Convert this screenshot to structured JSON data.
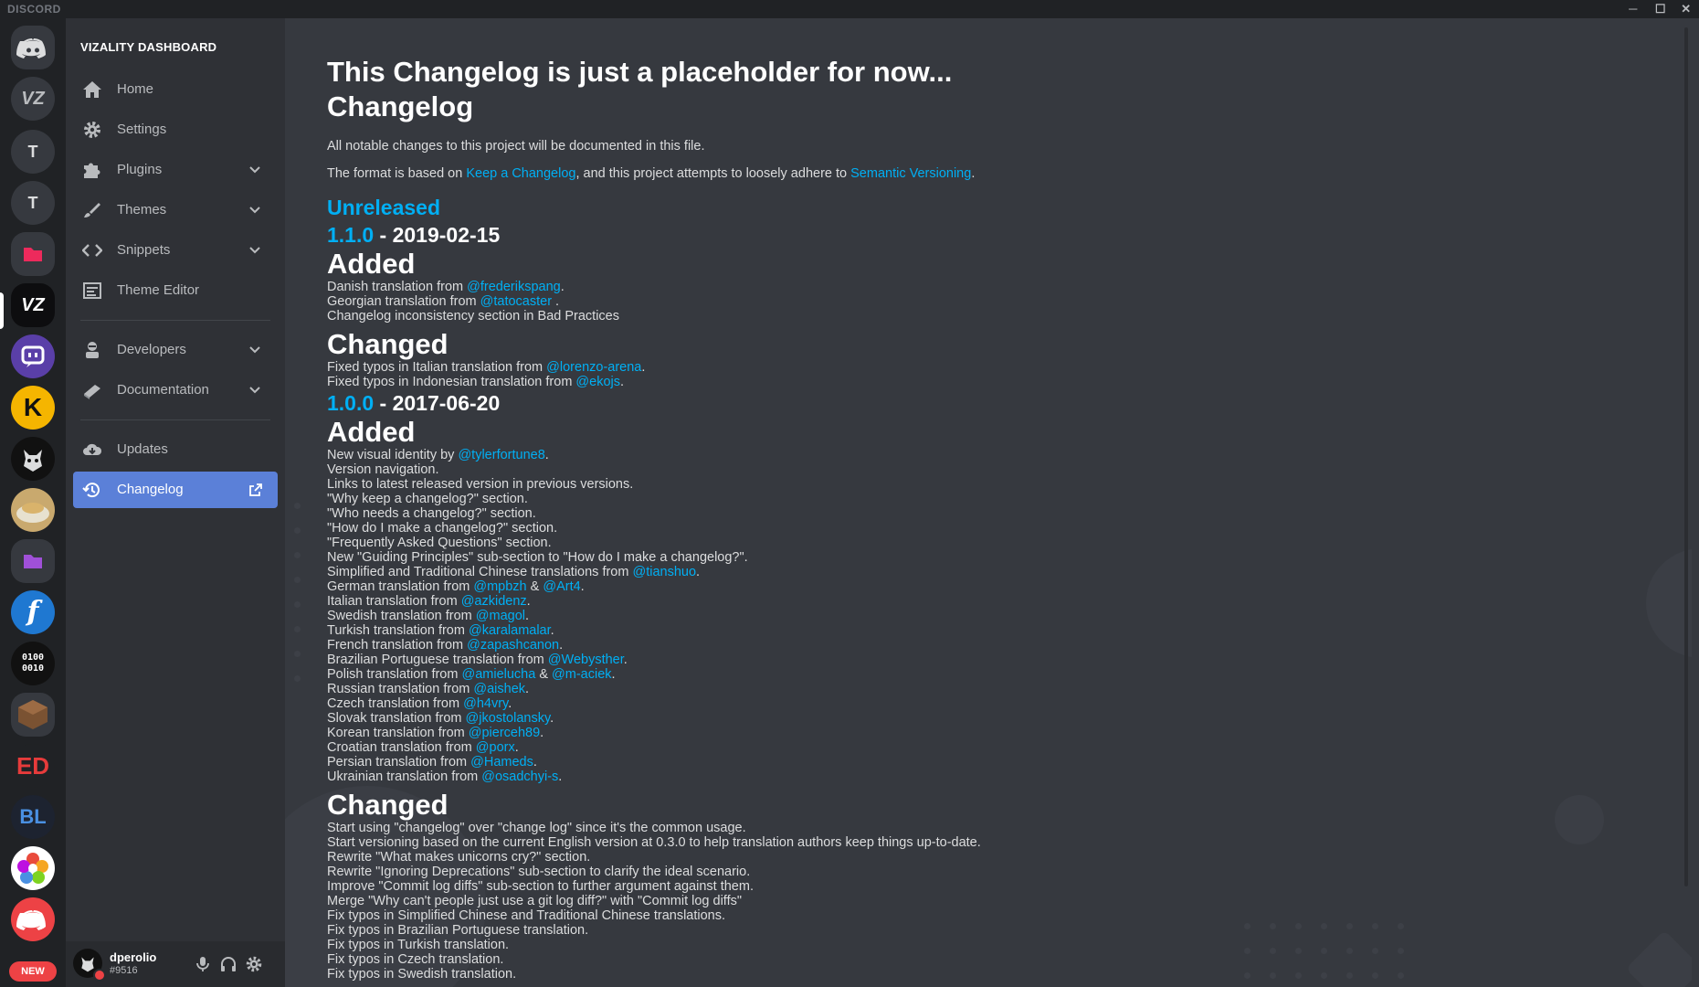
{
  "window": {
    "brand": "DISCORD",
    "minimize": "─",
    "maximize": "☐",
    "close": "✕"
  },
  "rail": {
    "servers": [
      {
        "name": "discord-home",
        "label": ""
      },
      {
        "name": "vizality",
        "label": "VZ"
      },
      {
        "name": "t1",
        "label": "T"
      },
      {
        "name": "t2",
        "label": "T"
      },
      {
        "name": "folder-red",
        "label": ""
      },
      {
        "name": "vizality-active",
        "label": "VZ"
      },
      {
        "name": "twitch-like",
        "label": ""
      },
      {
        "name": "k-server",
        "label": "K"
      },
      {
        "name": "demon-server",
        "label": ""
      },
      {
        "name": "food-server",
        "label": ""
      },
      {
        "name": "folder-purple",
        "label": ""
      },
      {
        "name": "f-server",
        "label": "f"
      },
      {
        "name": "binary-server",
        "label": "0100 0010"
      },
      {
        "name": "minecraft-server",
        "label": ""
      },
      {
        "name": "ed-server",
        "label": "ED"
      },
      {
        "name": "bl-server",
        "label": "BL"
      },
      {
        "name": "flower-server",
        "label": ""
      },
      {
        "name": "discord-red",
        "label": ""
      }
    ],
    "new_badge": "NEW"
  },
  "sidebar": {
    "title": "VIZALITY DASHBOARD",
    "items": [
      {
        "label": "Home"
      },
      {
        "label": "Settings"
      },
      {
        "label": "Plugins"
      },
      {
        "label": "Themes"
      },
      {
        "label": "Snippets"
      },
      {
        "label": "Theme Editor"
      },
      {
        "label": "Developers"
      },
      {
        "label": "Documentation"
      },
      {
        "label": "Updates"
      },
      {
        "label": "Changelog"
      }
    ]
  },
  "user": {
    "name": "dperolio",
    "tag": "#9516"
  },
  "changelog": {
    "title": "This Changelog is just a placeholder for now...",
    "heading": "Changelog",
    "intro": "All notable changes to this project will be documented in this file.",
    "format_pre": "The format is based on ",
    "format_link1": "Keep a Changelog",
    "format_mid": ", and this project attempts to loosely adhere to ",
    "format_link2": "Semantic Versioning",
    "format_post": ".",
    "unreleased": "Unreleased",
    "v110": {
      "version": "1.1.0",
      "date": " - 2019-02-15"
    },
    "v100": {
      "version": "1.0.0",
      "date": " - 2017-06-20"
    },
    "added": "Added",
    "changed": "Changed",
    "v110_added": [
      {
        "pre": "Danish translation from ",
        "link": "@frederikspang",
        "post": "."
      },
      {
        "pre": "Georgian translation from ",
        "link": "@tatocaster",
        "post": " ."
      },
      {
        "pre": "Changelog inconsistency section in Bad Practices",
        "link": "",
        "post": ""
      }
    ],
    "v110_changed": [
      {
        "pre": "Fixed typos in Italian translation from ",
        "link": "@lorenzo-arena",
        "post": "."
      },
      {
        "pre": "Fixed typos in Indonesian translation from ",
        "link": "@ekojs",
        "post": "."
      }
    ],
    "v100_added": [
      {
        "pre": "New visual identity by ",
        "link": "@tylerfortune8",
        "post": "."
      },
      {
        "pre": "Version navigation.",
        "link": "",
        "post": ""
      },
      {
        "pre": "Links to latest released version in previous versions.",
        "link": "",
        "post": ""
      },
      {
        "pre": "\"Why keep a changelog?\" section.",
        "link": "",
        "post": ""
      },
      {
        "pre": "\"Who needs a changelog?\" section.",
        "link": "",
        "post": ""
      },
      {
        "pre": "\"How do I make a changelog?\" section.",
        "link": "",
        "post": ""
      },
      {
        "pre": "\"Frequently Asked Questions\" section.",
        "link": "",
        "post": ""
      },
      {
        "pre": "New \"Guiding Principles\" sub-section to \"How do I make a changelog?\".",
        "link": "",
        "post": ""
      },
      {
        "pre": "Simplified and Traditional Chinese translations from ",
        "link": "@tianshuo",
        "post": "."
      },
      {
        "pre": "German translation from ",
        "link": "@mpbzh",
        "post": " & ",
        "link2": "@Art4",
        "post2": "."
      },
      {
        "pre": "Italian translation from ",
        "link": "@azkidenz",
        "post": "."
      },
      {
        "pre": "Swedish translation from ",
        "link": "@magol",
        "post": "."
      },
      {
        "pre": "Turkish translation from ",
        "link": "@karalamalar",
        "post": "."
      },
      {
        "pre": "French translation from ",
        "link": "@zapashcanon",
        "post": "."
      },
      {
        "pre": "Brazilian Portuguese translation from ",
        "link": "@Webysther",
        "post": "."
      },
      {
        "pre": "Polish translation from ",
        "link": "@amielucha",
        "post": " & ",
        "link2": "@m-aciek",
        "post2": "."
      },
      {
        "pre": "Russian translation from ",
        "link": "@aishek",
        "post": "."
      },
      {
        "pre": "Czech translation from ",
        "link": "@h4vry",
        "post": "."
      },
      {
        "pre": "Slovak translation from ",
        "link": "@jkostolansky",
        "post": "."
      },
      {
        "pre": "Korean translation from ",
        "link": "@pierceh89",
        "post": "."
      },
      {
        "pre": "Croatian translation from ",
        "link": "@porx",
        "post": "."
      },
      {
        "pre": "Persian translation from ",
        "link": "@Hameds",
        "post": "."
      },
      {
        "pre": "Ukrainian translation from ",
        "link": "@osadchyi-s",
        "post": "."
      }
    ],
    "v100_changed": [
      {
        "pre": "Start using \"changelog\" over \"change log\" since it's the common usage.",
        "link": "",
        "post": ""
      },
      {
        "pre": "Start versioning based on the current English version at 0.3.0 to help translation authors keep things up-to-date.",
        "link": "",
        "post": ""
      },
      {
        "pre": "Rewrite \"What makes unicorns cry?\" section.",
        "link": "",
        "post": ""
      },
      {
        "pre": "Rewrite \"Ignoring Deprecations\" sub-section to clarify the ideal scenario.",
        "link": "",
        "post": ""
      },
      {
        "pre": "Improve \"Commit log diffs\" sub-section to further argument against them.",
        "link": "",
        "post": ""
      },
      {
        "pre": "Merge \"Why can't people just use a git log diff?\" with \"Commit log diffs\"",
        "link": "",
        "post": ""
      },
      {
        "pre": "Fix typos in Simplified Chinese and Traditional Chinese translations.",
        "link": "",
        "post": ""
      },
      {
        "pre": "Fix typos in Brazilian Portuguese translation.",
        "link": "",
        "post": ""
      },
      {
        "pre": "Fix typos in Turkish translation.",
        "link": "",
        "post": ""
      },
      {
        "pre": "Fix typos in Czech translation.",
        "link": "",
        "post": ""
      },
      {
        "pre": "Fix typos in Swedish translation.",
        "link": "",
        "post": ""
      }
    ]
  },
  "colors": {
    "accent": "#5b80d8",
    "link": "#00aff4",
    "background": "#36393f",
    "sidebar": "#2f3136",
    "rail": "#202225"
  }
}
